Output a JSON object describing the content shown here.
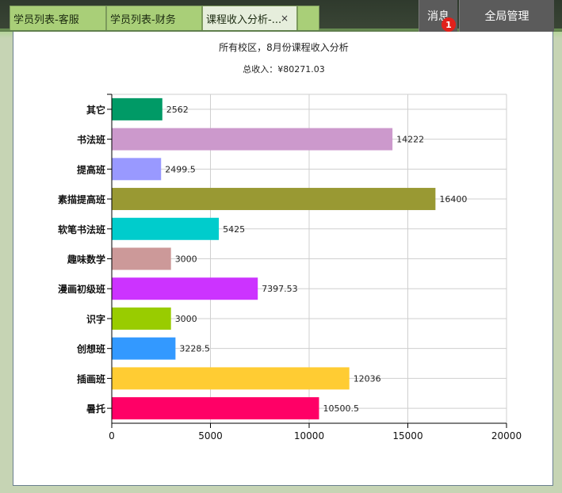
{
  "tabs": [
    {
      "label": "学员列表-客服",
      "active": false
    },
    {
      "label": "学员列表-财务",
      "active": false
    },
    {
      "label": "课程收入分析-...",
      "active": true,
      "close": "×"
    },
    {
      "label": "",
      "active": false
    }
  ],
  "header": {
    "messages_label": "消息",
    "messages_badge": "1",
    "admin_label": "全局管理"
  },
  "colors": {
    "topbar": "#343f32",
    "tab": "#a9cf78",
    "page_bg": "#c6d4b4"
  },
  "chart_data": {
    "type": "bar",
    "orientation": "horizontal",
    "title": "所有校区，8月份课程收入分析",
    "subtitle": "总收入：¥80271.03",
    "categories": [
      "其它",
      "书法班",
      "提高班",
      "素描提高班",
      "软笔书法班",
      "趣味数学",
      "漫画初级班",
      "识字",
      "创想班",
      "插画班",
      "暑托"
    ],
    "values": [
      2562,
      14222,
      2499.5,
      16400,
      5425,
      3000,
      7397.53,
      3000,
      3228.5,
      12036,
      10500.5
    ],
    "value_labels": [
      "2562",
      "14222",
      "2499.5",
      "16400",
      "5425",
      "3000",
      "7397.53",
      "3000",
      "3228.5",
      "12036",
      "10500.5"
    ],
    "bar_colors": [
      "#009a66",
      "#cc99cc",
      "#9999ff",
      "#999933",
      "#00cccc",
      "#cc9999",
      "#cc33ff",
      "#99cc00",
      "#3399ff",
      "#ffcc33",
      "#ff0066"
    ],
    "xlim": [
      0,
      20000
    ],
    "xticks": [
      0,
      5000,
      10000,
      15000,
      20000
    ],
    "xtick_labels": [
      "0",
      "5000",
      "10000",
      "15000",
      "20000"
    ],
    "grid": true,
    "xlabel": "",
    "ylabel": ""
  }
}
